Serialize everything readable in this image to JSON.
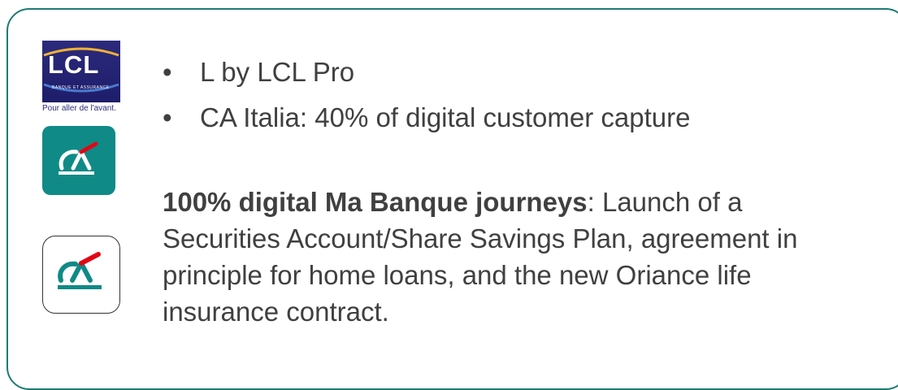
{
  "logos": {
    "lcl": {
      "name": "LCL",
      "subtitle": "BANQUE ET ASSURANCE",
      "tagline": "Pour aller de l'avant."
    },
    "ca_app_teal": {
      "icon": "credit-agricole-logo-icon",
      "color": "#0f8a86"
    },
    "ca_app_white": {
      "icon": "credit-agricole-logo-icon",
      "color": "#ffffff"
    }
  },
  "bullets": [
    {
      "marker": "•",
      "text": "L by LCL Pro"
    },
    {
      "marker": "•",
      "text": "CA Italia: 40% of digital customer capture"
    }
  ],
  "paragraph": {
    "bold": "100% digital Ma Banque journeys",
    "rest": ": Launch of a Securities Account/Share Savings Plan, agreement in principle for home loans, and the new Oriance life insurance contract."
  },
  "colors": {
    "frame_border": "#1f7a73",
    "text": "#404040",
    "lcl_blue": "#2c2a7c",
    "ca_green": "#0f8a86",
    "ca_red": "#e30613"
  }
}
